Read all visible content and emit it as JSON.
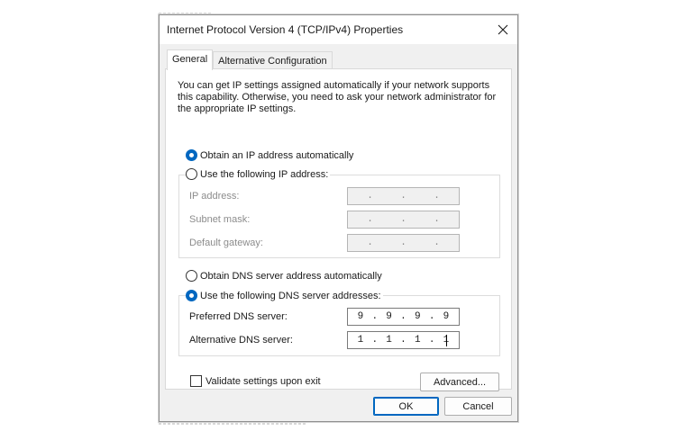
{
  "window": {
    "title": "Internet Protocol Version 4 (TCP/IPv4) Properties"
  },
  "tabs": [
    {
      "label": "General",
      "active": true
    },
    {
      "label": "Alternative Configuration",
      "active": false
    }
  ],
  "intro": "You can get IP settings assigned automatically if your network supports this capability. Otherwise, you need to ask your network administrator for the appropriate IP settings.",
  "ip_section": {
    "auto_label": "Obtain an IP address automatically",
    "manual_label": "Use the following IP address:",
    "auto_selected": true,
    "fields": [
      {
        "label": "IP address:",
        "value": [
          ".",
          ".",
          "."
        ]
      },
      {
        "label": "Subnet mask:",
        "value": [
          ".",
          ".",
          "."
        ]
      },
      {
        "label": "Default gateway:",
        "value": [
          ".",
          ".",
          "."
        ]
      }
    ]
  },
  "dns_section": {
    "auto_label": "Obtain DNS server address automatically",
    "manual_label": "Use the following DNS server addresses:",
    "manual_selected": true,
    "preferred": {
      "label": "Preferred DNS server:",
      "octets": [
        "9",
        ".",
        "9",
        ".",
        "9",
        ".",
        "9"
      ]
    },
    "alternative": {
      "label": "Alternative DNS server:",
      "octets": [
        "1",
        ".",
        "1",
        ".",
        "1",
        ".",
        "1"
      ]
    }
  },
  "validate": {
    "label": "Validate settings upon exit",
    "checked": false
  },
  "buttons": {
    "advanced": "Advanced...",
    "ok": "OK",
    "cancel": "Cancel"
  },
  "colors": {
    "accent": "#0067c0",
    "dialog_bg": "#f0f0f0"
  }
}
